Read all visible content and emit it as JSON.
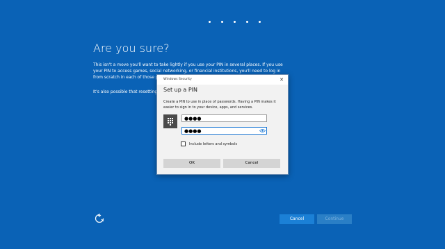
{
  "progress_dots": 5,
  "page": {
    "title": "Are you sure?",
    "paragraph1": "This isn't a move you'll want to take lightly if you use your PIN in several places. If you use your PIN to access games, social networking, or financial institutions, you'll need to log in from scratch in each of those places after you reset your",
    "paragraph2": "It's also possible that resetting yo company or organization."
  },
  "footer": {
    "accessibility_icon": "ease-of-access-icon",
    "cancel_label": "Cancel",
    "continue_label": "Continue"
  },
  "dialog": {
    "caption": "Windows Security",
    "close_glyph": "✕",
    "heading": "Set up a PIN",
    "description": "Create a PIN to use in place of passwords. Having a PIN makes it easier to sign in to your device, apps, and services.",
    "keypad_icon": "keypad-icon",
    "pin_value": "●●●●",
    "confirm_value": "●●●●",
    "reveal_icon": "eye-icon",
    "checkbox_label": "Include letters and symbols",
    "checkbox_checked": false,
    "ok_label": "OK",
    "cancel_label": "Cancel"
  },
  "colors": {
    "background": "#0a62b6",
    "dialog_bg": "#f2f2f2",
    "accent": "#1e7ad6",
    "button_gray": "#d4d4d4"
  }
}
